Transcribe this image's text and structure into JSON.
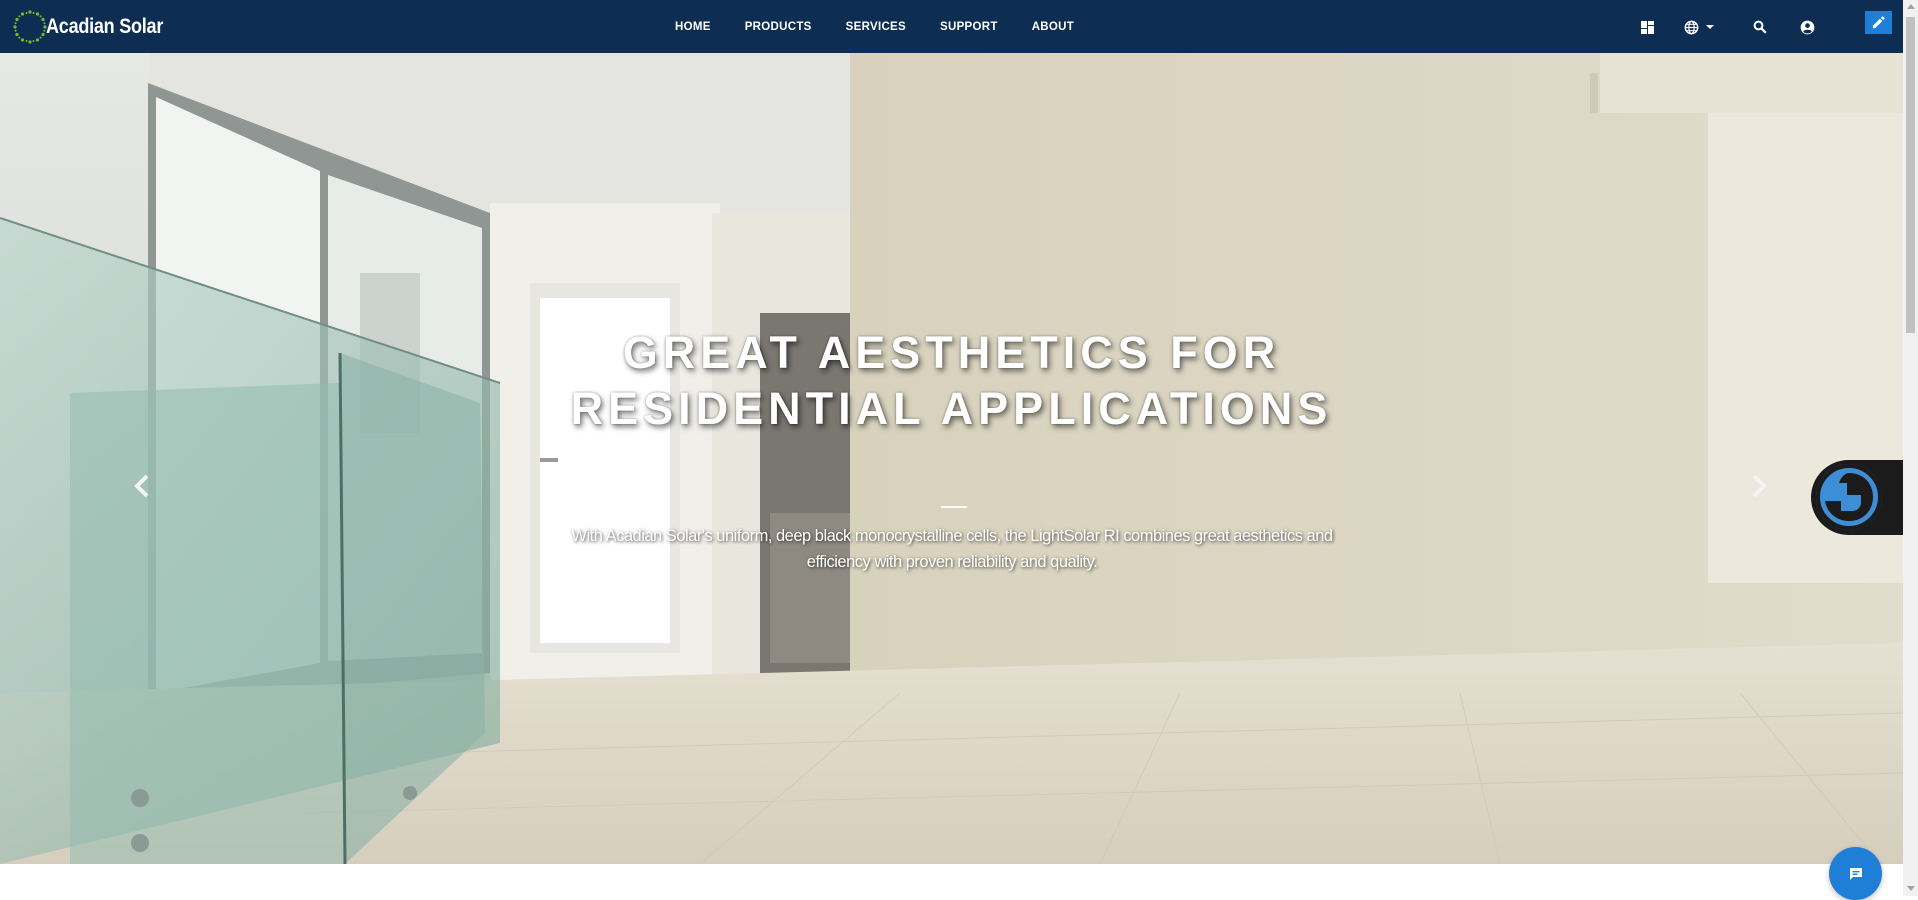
{
  "brand": {
    "name": "Acadian Solar",
    "logo_icon": "sun-dots-logo",
    "logo_color": "#6fbf2a"
  },
  "nav": {
    "items": [
      "HOME",
      "PRODUCTS",
      "SERVICES",
      "SUPPORT",
      "ABOUT"
    ],
    "icons": [
      "dashboard-icon",
      "globe-icon",
      "chevron-down-icon",
      "search-icon",
      "account-icon",
      "edit-icon"
    ]
  },
  "hero": {
    "title_line1": "GREAT AESTHETICS FOR",
    "title_line2": "RESIDENTIAL APPLICATIONS",
    "subtitle": "With Acadian Solar's uniform, deep black monocrystalline cells, the LightSolar RI combines great aesthetics and efficiency with proven reliability and quality.",
    "slide_count": 3,
    "active_slide": 1,
    "prev_icon": "chevron-left-icon",
    "next_icon": "chevron-right-icon"
  },
  "widgets": {
    "accessibility_icon": "accessibility-icon",
    "chat_icon": "chat-icon"
  },
  "colors": {
    "nav_bg": "#0e2d52",
    "accent": "#1f7fd6",
    "text_on_dark": "#ffffff"
  }
}
